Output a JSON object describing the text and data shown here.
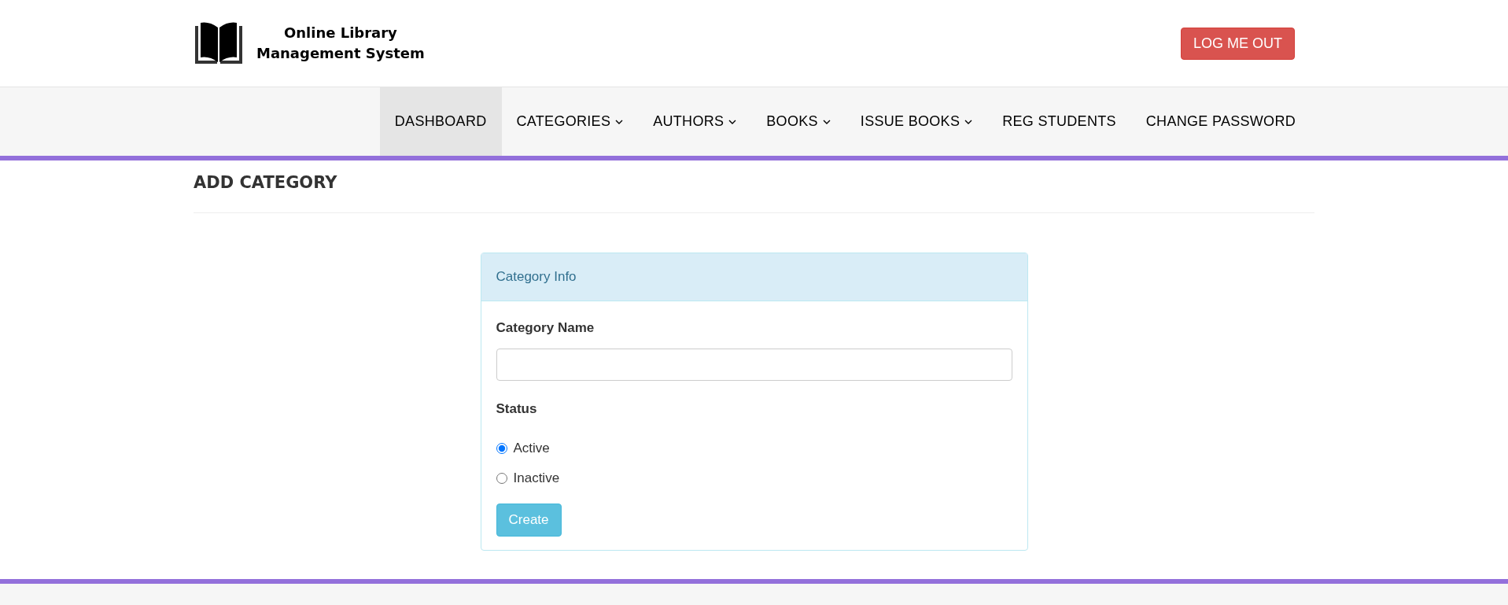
{
  "header": {
    "logo_text": [
      "Online Library",
      "Management System"
    ],
    "logout_button": "LOG ME OUT"
  },
  "nav": [
    {
      "label": "DASHBOARD",
      "selected": true,
      "dropdown": false
    },
    {
      "label": "CATEGORIES",
      "selected": false,
      "dropdown": true
    },
    {
      "label": "AUTHORS",
      "selected": false,
      "dropdown": true
    },
    {
      "label": "BOOKS",
      "selected": false,
      "dropdown": true
    },
    {
      "label": "ISSUE BOOKS",
      "selected": false,
      "dropdown": true
    },
    {
      "label": "REG STUDENTS",
      "selected": false,
      "dropdown": false
    },
    {
      "label": "CHANGE PASSWORD",
      "selected": false,
      "dropdown": false
    }
  ],
  "page_title": "ADD CATEGORY",
  "panel": {
    "heading": "Category Info",
    "name_label": "Category Name",
    "status_label": "Status",
    "status_options": [
      {
        "label": "Active",
        "selected": true
      },
      {
        "label": "Inactive",
        "selected": false
      }
    ],
    "submit_button": "Create"
  }
}
